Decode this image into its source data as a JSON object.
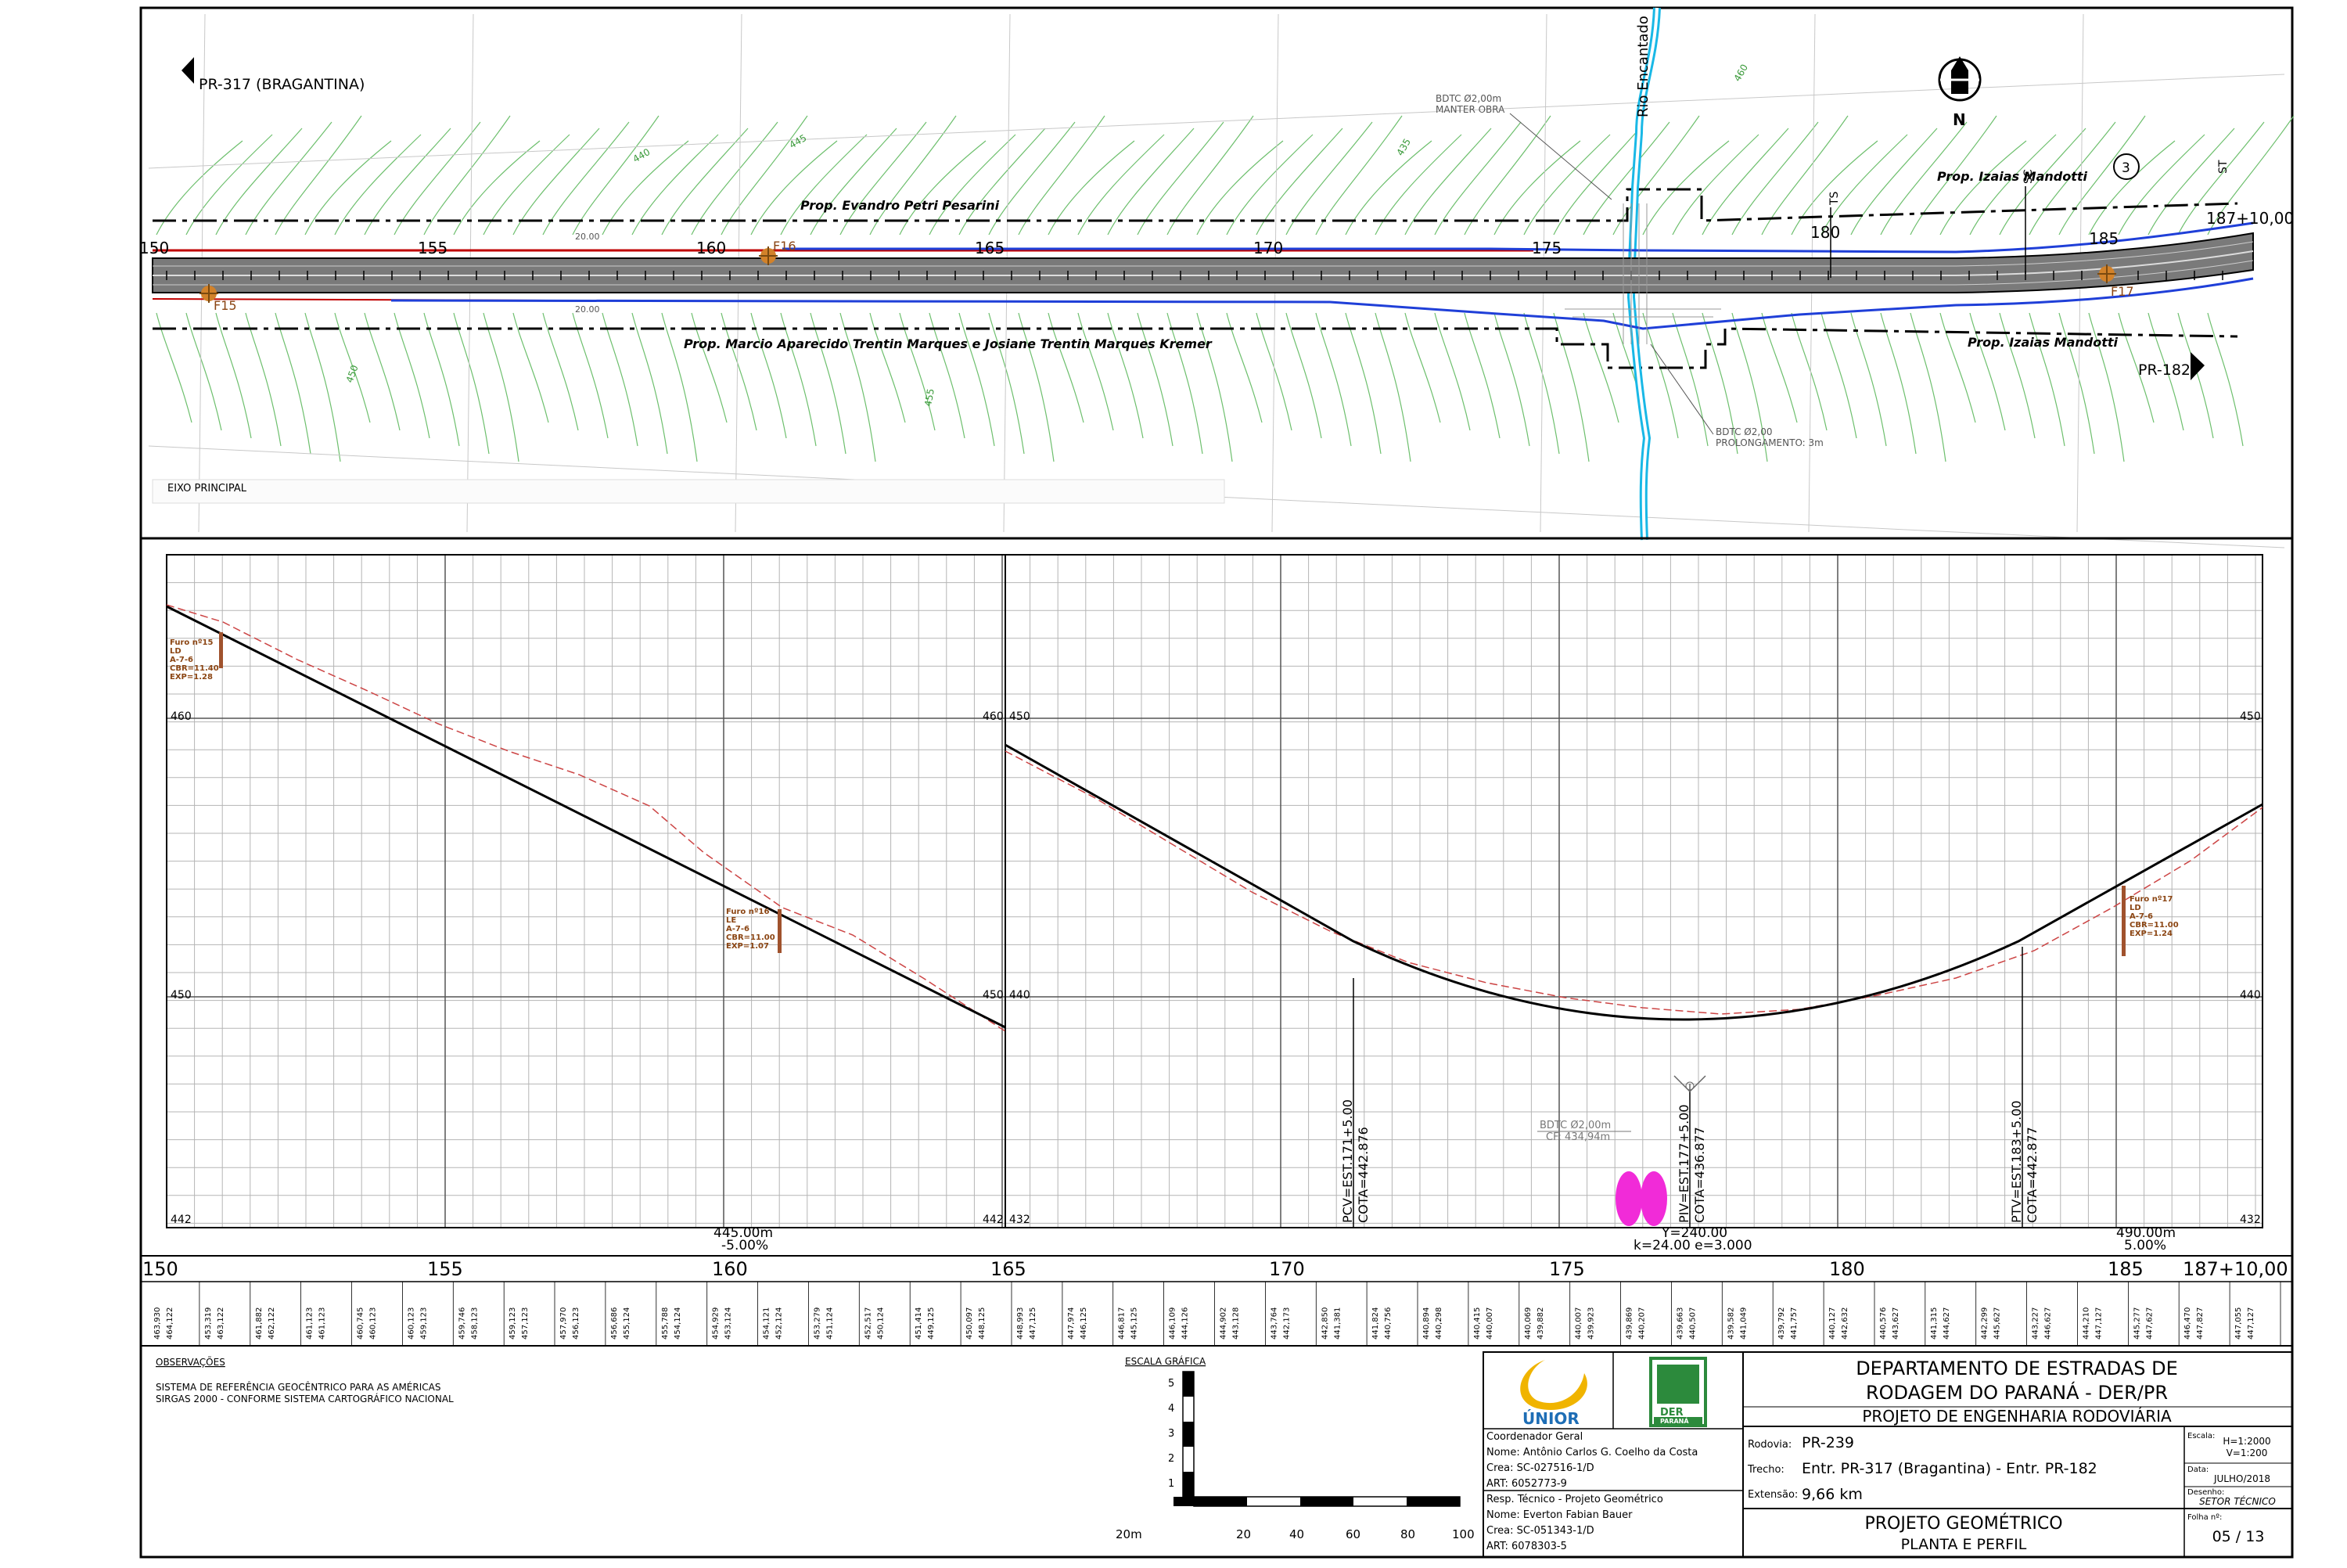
{
  "plan": {
    "direction_west": "PR-317 (BRAGANTINA)",
    "direction_east": "PR-182",
    "north": "N",
    "axis_label": "EIXO PRINCIPAL",
    "river": "Rio Encantado",
    "culvert_top": [
      "BDTC Ø2,00m",
      "MANTER OBRA"
    ],
    "culvert_bottom": [
      "BDTC Ø2,00",
      "PROLONGAMENTO: 3m"
    ],
    "prop_north_1": "Prop. Evandro Petri Pesarini",
    "prop_north_2": "Prop. Izaias Mandotti",
    "prop_south_1": "Prop. Marcio Aparecido Trentin Marques e Josiane Trentin Marques Kremer",
    "prop_south_2": "Prop. Izaias Mandotti",
    "circle_num": "3",
    "stations": [
      "150",
      "155",
      "160",
      "165",
      "170",
      "175",
      "180",
      "185",
      "187+10,00"
    ],
    "boreholes": [
      "F15",
      "F16",
      "F17"
    ],
    "curve_marks": [
      "TS",
      "SC",
      "ST"
    ],
    "contour_labels": [
      "440",
      "445",
      "450",
      "455",
      "460",
      "435"
    ],
    "width_labels": [
      "20.00",
      "20.00"
    ]
  },
  "profile": {
    "left_elev": [
      "460",
      "450",
      "442"
    ],
    "right_elev": [
      "450",
      "440",
      "432"
    ],
    "stations": [
      "150",
      "155",
      "160",
      "165",
      "170",
      "175",
      "180",
      "185",
      "187+10,00"
    ],
    "furos": [
      {
        "lines": [
          "Furo nº15",
          "LD",
          "A-7-6",
          "CBR=11.40",
          "EXP=1.28"
        ]
      },
      {
        "lines": [
          "Furo nº16",
          "LE",
          "A-7-6",
          "CBR=11.00",
          "EXP=1.07"
        ]
      },
      {
        "lines": [
          "Furo nº17",
          "LD",
          "A-7-6",
          "CBR=11.00",
          "EXP=1.24"
        ]
      }
    ],
    "pcv": [
      "PCV=EST.171+5.00",
      "COTA=442.876"
    ],
    "piv": [
      "PIV=EST.177+5.00",
      "COTA=436.877"
    ],
    "ptv": [
      "PTV=EST.183+5.00",
      "COTA=442.877"
    ],
    "bdtc": [
      "BDTC Ø2,00m",
      "CF: 434,94m"
    ],
    "grade1": [
      "445.00m",
      "-5.00%"
    ],
    "vcurve": [
      "Y=240.00",
      "k=24.00  e=3.000"
    ],
    "grade2": [
      "490.00m",
      "5.00%"
    ],
    "elev_terrain": [
      "463,930",
      "453,319",
      "461,882",
      "461,123",
      "460,745",
      "460,123",
      "459,746",
      "459,123",
      "457,970",
      "456,686",
      "455,788",
      "454,929",
      "454,121",
      "453,279",
      "452,517",
      "451,414",
      "450,097",
      "448,993",
      "447,974",
      "446,817",
      "446,109",
      "444,902",
      "443,764",
      "442,850",
      "441,824",
      "440,894",
      "440,415",
      "440,069",
      "440,007",
      "439,869",
      "439,663",
      "439,582",
      "439,792",
      "440,127",
      "440,576",
      "441,315",
      "442,299",
      "443,227",
      "444,210",
      "445,277",
      "446,470",
      "447,055"
    ],
    "elev_grade": [
      "464,122",
      "463,122",
      "462,122",
      "461,123",
      "460,123",
      "459,123",
      "458,123",
      "457,123",
      "456,123",
      "455,124",
      "454,124",
      "453,124",
      "452,124",
      "451,124",
      "450,124",
      "449,125",
      "448,125",
      "447,125",
      "446,125",
      "445,125",
      "444,126",
      "443,128",
      "442,173",
      "441,381",
      "440,756",
      "440,298",
      "440,007",
      "439,882",
      "439,923",
      "440,207",
      "440,507",
      "441,049",
      "441,757",
      "442,632",
      "443,627",
      "444,627",
      "445,627",
      "446,627",
      "447,127",
      "447,627",
      "447,827",
      "447,127"
    ]
  },
  "notes": {
    "heading": "OBSERVAÇÕES",
    "lines": [
      "SISTEMA DE REFERÊNCIA GEOCÊNTRICO PARA AS AMÉRICAS",
      "SIRGAS 2000 - CONFORME SISTEMA CARTOGRÁFICO NACIONAL"
    ]
  },
  "scale": {
    "title": "ESCALA GRÁFICA",
    "h_ticks": [
      "20m",
      "20",
      "40",
      "60",
      "80",
      "100"
    ],
    "v_ticks": [
      "5",
      "4",
      "3",
      "2",
      "1"
    ]
  },
  "titleblock": {
    "logo1": "ÚNIOR",
    "logo2_top": "DER",
    "logo2_bottom": "PARANÁ",
    "coord_heading": "Coordenador Geral",
    "coord_lines": [
      "Nome: Antônio Carlos G. Coelho da Costa",
      "Crea:   SC-027516-1/D",
      "ART:    6052773-9"
    ],
    "resp_heading": "Resp. Técnico - Projeto Geométrico",
    "resp_lines": [
      "Nome: Everton Fabian Bauer",
      "Crea:   SC-051343-1/D",
      "ART:    6078303-5"
    ],
    "dept_line1": "DEPARTAMENTO DE ESTRADAS DE",
    "dept_line2": "RODAGEM DO PARANÁ - DER/PR",
    "project": "PROJETO DE ENGENHARIA RODOVIÁRIA",
    "rodovia_label": "Rodovia:",
    "rodovia": "PR-239",
    "trecho_label": "Trecho:",
    "trecho": "Entr. PR-317 (Bragantina) - Entr. PR-182",
    "extensao_label": "Extensão:",
    "extensao": "9,66 km",
    "sheet_title1": "PROJETO GEOMÉTRICO",
    "sheet_title2": "PLANTA E PERFIL",
    "escala_label": "Escala:",
    "escala_h": "H=1:2000",
    "escala_v": "V=1:200",
    "data_label": "Data:",
    "data": "JULHO/2018",
    "desenho_label": "Desenho:",
    "desenho": "SETOR TÉCNICO",
    "folha_label": "Folha nº:",
    "folha": "05 / 13"
  }
}
